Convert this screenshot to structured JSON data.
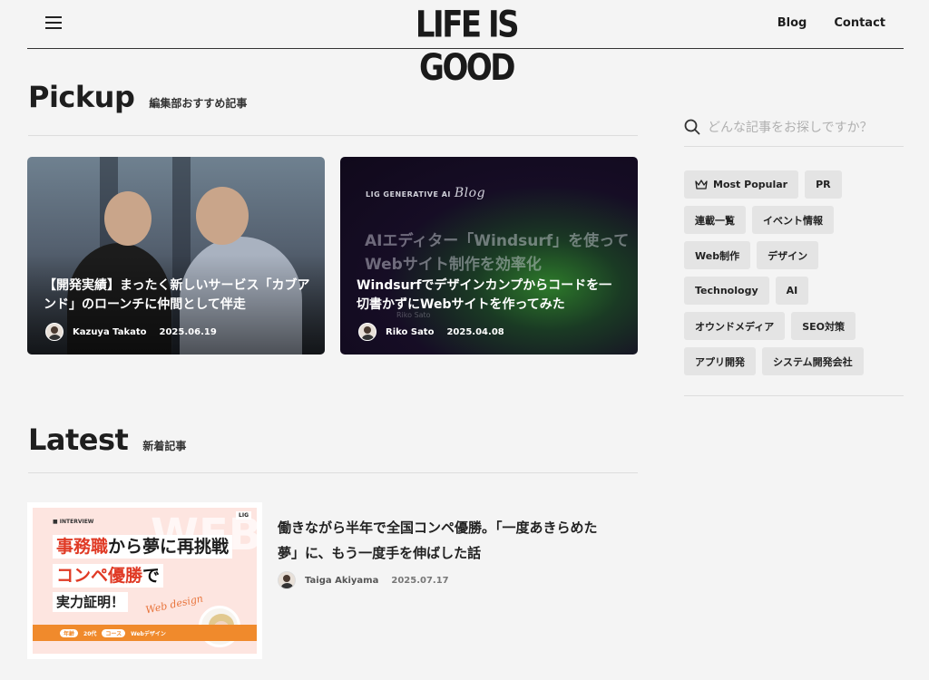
{
  "header": {
    "logo": "LIFE IS GOOD",
    "nav": [
      "Blog",
      "Contact"
    ]
  },
  "pickup": {
    "title": "Pickup",
    "subtitle": "編集部おすすめ記事",
    "cards": [
      {
        "title": "【開発実績】まったく新しいサービス「カブアンド」のローンチに仲間として伴走",
        "author": "Kazuya Takato",
        "date": "2025.06.19"
      },
      {
        "title": "Windsurfでデザインカンプからコードを一切書かずにWebサイトを作ってみた",
        "author": "Riko Sato",
        "date": "2025.04.08",
        "image_label": "LIG GENERATIVE AI",
        "image_label_script": "Blog",
        "image_headline": "AIエディター「Windsurf」を使って\nWebサイト制作を効率化",
        "image_author": "Riko Sato"
      }
    ]
  },
  "latest": {
    "title": "Latest",
    "subtitle": "新着記事",
    "items": [
      {
        "title": "働きながら半年で全国コンペ優勝。「一度あきらめた夢」に、もう一度手を伸ばした話",
        "author": "Taiga Akiyama",
        "date": "2025.07.17",
        "thumb": {
          "interview": "INTERVIEW",
          "line1_red": "事務職",
          "line1_rest": "から夢に再挑戦",
          "line2_red": "コンペ優勝",
          "line2_rest": "で",
          "line3": "実力証明！",
          "script": "Web design",
          "bar_pill1": "年齢",
          "bar_age": "20代",
          "bar_pill2": "コース",
          "bar_course": "Webデザイン",
          "watermark": "WEB"
        }
      }
    ]
  },
  "sidebar": {
    "search_placeholder": "どんな記事をお探しですか？",
    "tags": [
      "Most Popular",
      "PR",
      "連載一覧",
      "イベント情報",
      "Web制作",
      "デザイン",
      "Technology",
      "AI",
      "オウンドメディア",
      "SEO対策",
      "アプリ開発",
      "システム開発会社"
    ]
  }
}
